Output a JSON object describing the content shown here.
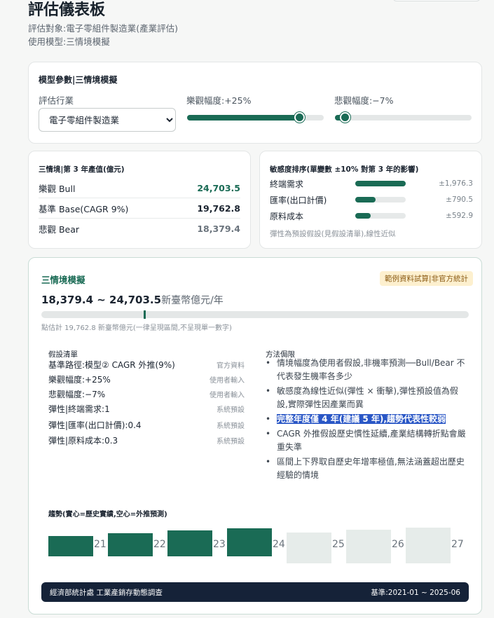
{
  "header": {
    "title": "評估儀表板",
    "target": "評估對象:電子零組件製造業(產業評估)",
    "model": "使用模型:三情境模擬"
  },
  "params": {
    "title": "模型參數|三情境模擬",
    "industry_label": "評估行業",
    "industry_value": "電子零組件製造業",
    "bull_label": "樂觀幅度:+25%",
    "bull_level": 0.82,
    "bear_label": "悲觀幅度:−7%",
    "bear_level": 0.07
  },
  "scenario": {
    "title": "三情境|第 3 年產值(億元)",
    "rows": [
      {
        "name": "樂觀 Bull",
        "value": "24,703.5"
      },
      {
        "name": "基準 Base(CAGR 9%)",
        "value": "19,762.8"
      },
      {
        "name": "悲觀 Bear",
        "value": "18,379.4"
      }
    ]
  },
  "sensitivity": {
    "title": "敏感度排序(單變數 ±10% 對第 3 年的影響)",
    "rows": [
      {
        "name": "終端需求",
        "value": "±1,976.3",
        "level": 1.0
      },
      {
        "name": "匯率(出口計價)",
        "value": "±790.5",
        "level": 0.4
      },
      {
        "name": "原料成本",
        "value": "±592.9",
        "level": 0.3
      }
    ],
    "note": "彈性為預設假設(見假設清單),線性近似"
  },
  "sim": {
    "title": "三情境模擬",
    "badge": "範例資料試算|非官方統計",
    "range_low": "18,379.4",
    "range_sep": " ~ ",
    "range_high": "24,703.5",
    "range_unit": "新臺幣億元/年",
    "point_level": 0.24,
    "point_note": "點估計 19,762.8 新臺幣億元(一律呈現區間,不呈現單一數字)",
    "assumptions_title": "假設清單",
    "assumptions": [
      {
        "text": "基準路徑:模型② CAGR 外推(9%)",
        "source": "官方資料"
      },
      {
        "text": "樂觀幅度:+25%",
        "source": "使用者輸入"
      },
      {
        "text": "悲觀幅度:−7%",
        "source": "使用者輸入"
      },
      {
        "text": "彈性|終端需求:1",
        "source": "系統預設"
      },
      {
        "text": "彈性|匯率(出口計價):0.4",
        "source": "系統預設"
      },
      {
        "text": "彈性|原料成本:0.3",
        "source": "系統預設"
      }
    ],
    "limits_title": "方法侷限",
    "limits": [
      "情境幅度為使用者假設,非機率預測──Bull/Bear 不代表發生機率各多少",
      "敏感度為線性近似(彈性 × 衝擊),彈性預設值為假設,實際彈性因產業而異",
      "完整年度僅 4 年(建議 5 年),趨勢代表性較弱",
      "CAGR 外推假設歷史慣性延續,產業結構轉折點會嚴重失準",
      "區間上下界取自歷史年增率極值,無法涵蓋超出歷史經驗的情境"
    ],
    "trend_title": "趨勢(實心=歷史實績,空心=外推預測)",
    "trend": [
      {
        "label": "21",
        "value": 0.47,
        "projected": false
      },
      {
        "label": "22",
        "value": 0.53,
        "projected": false
      },
      {
        "label": "23",
        "value": 0.59,
        "projected": false
      },
      {
        "label": "24",
        "value": 0.65,
        "projected": false
      },
      {
        "label": "25",
        "value": 0.71,
        "projected": true
      },
      {
        "label": "26",
        "value": 0.77,
        "projected": true
      },
      {
        "label": "27",
        "value": 0.83,
        "projected": true
      }
    ],
    "source": "經濟部統計處 工業產銷存動態調查",
    "base_period": "基準:2021-01 ~ 2025-06"
  }
}
